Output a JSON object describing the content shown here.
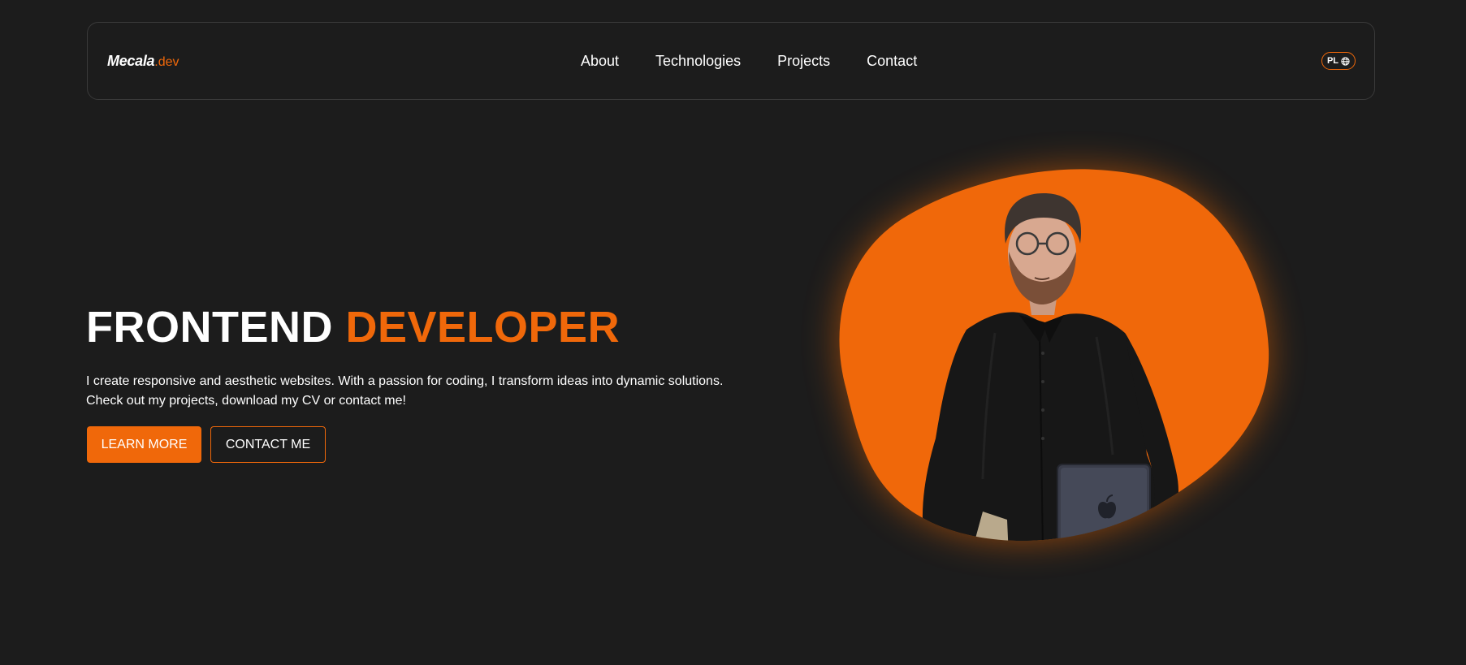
{
  "nav": {
    "logo_main": "Mecala",
    "logo_ext": ".dev",
    "links": [
      "About",
      "Technologies",
      "Projects",
      "Contact"
    ],
    "lang_label": "PL",
    "lang_icon": "globe-icon"
  },
  "hero": {
    "title_part1": "FRONTEND",
    "title_part2": "DEVELOPER",
    "description_line1": "I create responsive and aesthetic websites. With a passion for coding, I transform ideas into dynamic solutions.",
    "description_line2": "Check out my projects, download my CV or contact me!",
    "primary_button": "LEARN MORE",
    "secondary_button": "CONTACT ME",
    "portrait_icon": "developer-portrait"
  },
  "colors": {
    "background": "#1c1c1c",
    "accent": "#f0680a",
    "text": "#ffffff"
  }
}
